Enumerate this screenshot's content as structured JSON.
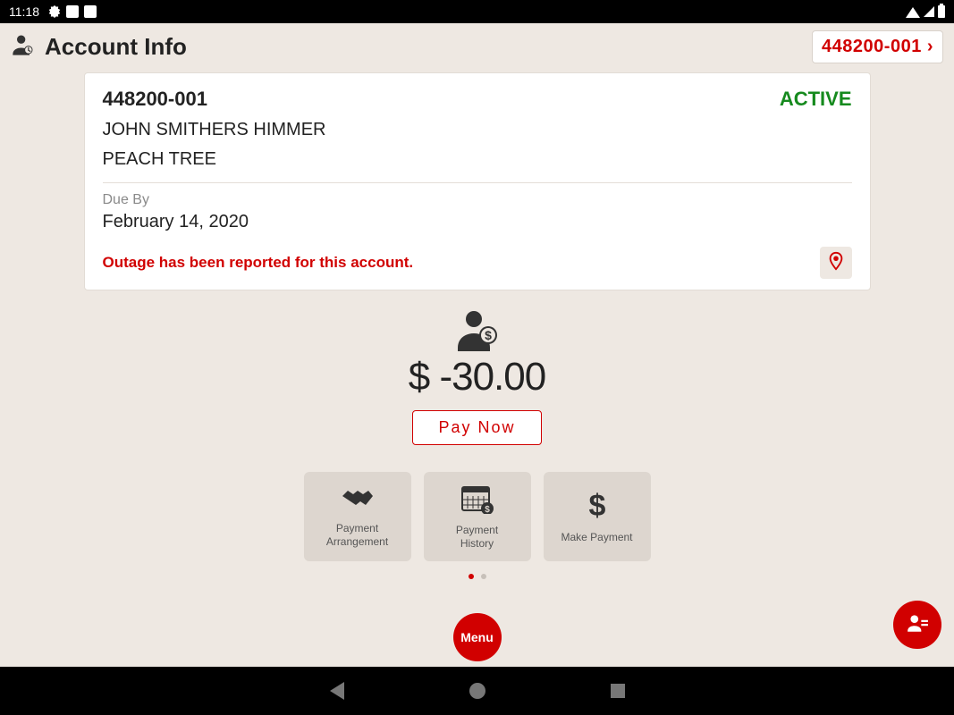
{
  "statusbar": {
    "time": "11:18"
  },
  "header": {
    "title": "Account Info",
    "account_chip": "448200-001"
  },
  "card": {
    "account_number": "448200-001",
    "status": "ACTIVE",
    "name": "JOHN SMITHERS HIMMER",
    "address": "PEACH TREE",
    "due_label": "Due By",
    "due_date": "February 14, 2020",
    "outage_msg": "Outage has been reported for this account."
  },
  "balance": {
    "amount": "$ -30.00",
    "pay_now_label": "Pay Now"
  },
  "tiles": [
    {
      "label": "Payment\nArrangement"
    },
    {
      "label": "Payment\nHistory"
    },
    {
      "label": "Make Payment"
    }
  ],
  "menu_label": "Menu"
}
